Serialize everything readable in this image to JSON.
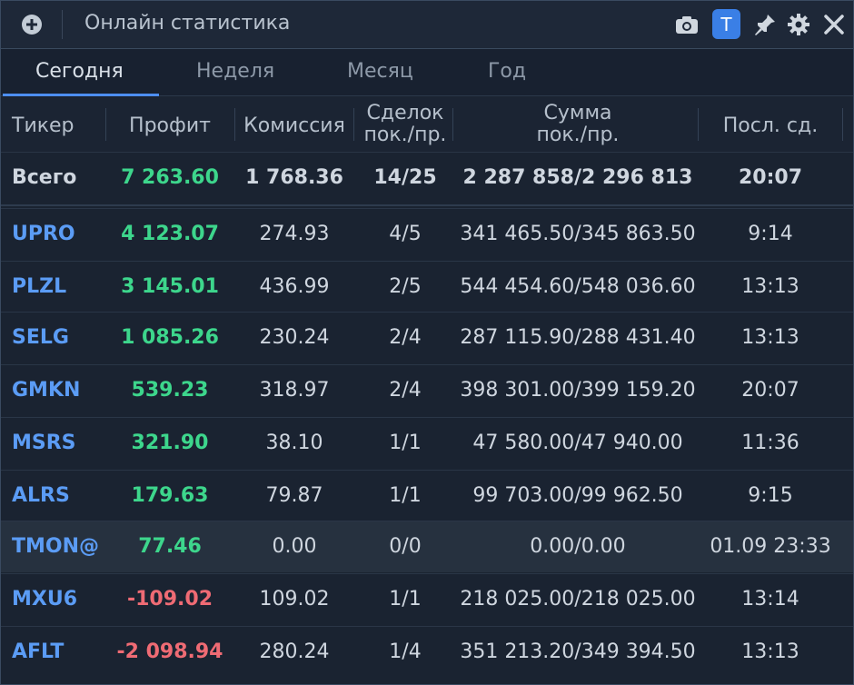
{
  "titlebar": {
    "title": "Онлайн статистика",
    "t_button": "T",
    "icons": [
      "add-circle-icon",
      "camera-icon",
      "pin-icon",
      "gear-icon",
      "close-icon"
    ]
  },
  "tabs": [
    {
      "label": "Сегодня",
      "active": true
    },
    {
      "label": "Неделя",
      "active": false
    },
    {
      "label": "Месяц",
      "active": false
    },
    {
      "label": "Год",
      "active": false
    }
  ],
  "columns": {
    "ticker": "Тикер",
    "profit": "Профит",
    "fee": "Комиссия",
    "deals_1": "Сделок",
    "deals_2": "пок./пр.",
    "sum_1": "Сумма",
    "sum_2": "пок./пр.",
    "last": "Посл. сд."
  },
  "total": {
    "ticker": "Всего",
    "profit": "7 263.60",
    "fee": "1 768.36",
    "deals": "14/25",
    "sum": "2 287 858/2 296 813",
    "last": "20:07"
  },
  "rows": [
    {
      "ticker": "UPRO",
      "profit": "4 123.07",
      "fee": "274.93",
      "deals": "4/5",
      "sum": "341 465.50/345 863.50",
      "last": "9:14",
      "sign": "pos"
    },
    {
      "ticker": "PLZL",
      "profit": "3 145.01",
      "fee": "436.99",
      "deals": "2/5",
      "sum": "544 454.60/548 036.60",
      "last": "13:13",
      "sign": "pos"
    },
    {
      "ticker": "SELG",
      "profit": "1 085.26",
      "fee": "230.24",
      "deals": "2/4",
      "sum": "287 115.90/288 431.40",
      "last": "13:13",
      "sign": "pos"
    },
    {
      "ticker": "GMKN",
      "profit": "539.23",
      "fee": "318.97",
      "deals": "2/4",
      "sum": "398 301.00/399 159.20",
      "last": "20:07",
      "sign": "pos"
    },
    {
      "ticker": "MSRS",
      "profit": "321.90",
      "fee": "38.10",
      "deals": "1/1",
      "sum": "47 580.00/47 940.00",
      "last": "11:36",
      "sign": "pos"
    },
    {
      "ticker": "ALRS",
      "profit": "179.63",
      "fee": "79.87",
      "deals": "1/1",
      "sum": "99 703.00/99 962.50",
      "last": "9:15",
      "sign": "pos"
    },
    {
      "ticker": "TMON@",
      "profit": "77.46",
      "fee": "0.00",
      "deals": "0/0",
      "sum": "0.00/0.00",
      "last": "01.09 23:33",
      "sign": "pos",
      "highlighted": true
    },
    {
      "ticker": "MXU6",
      "profit": "-109.02",
      "fee": "109.02",
      "deals": "1/1",
      "sum": "218 025.00/218 025.00",
      "last": "13:14",
      "sign": "neg"
    },
    {
      "ticker": "AFLT",
      "profit": "-2 098.94",
      "fee": "280.24",
      "deals": "1/4",
      "sum": "351 213.20/349 394.50",
      "last": "13:13",
      "sign": "neg"
    }
  ],
  "colors": {
    "positive": "#3dd68c",
    "negative": "#ef6b74",
    "ticker": "#5b9cf5",
    "accent": "#3a7fe6"
  }
}
